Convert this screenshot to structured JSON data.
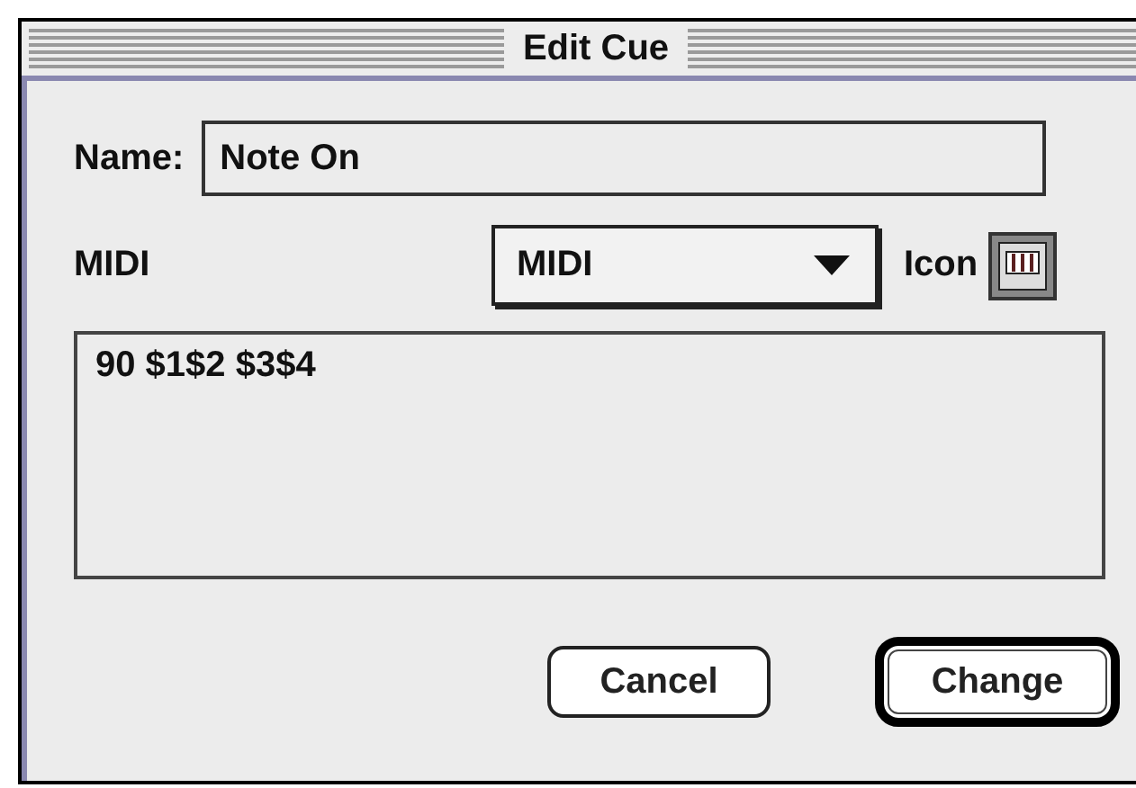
{
  "window": {
    "title": "Edit Cue"
  },
  "name_field": {
    "label": "Name:",
    "value": "Note On"
  },
  "midi_row": {
    "label": "MIDI",
    "dropdown": "MIDI",
    "icon_label": "Icon"
  },
  "message_text": "90 $1$2 $3$4",
  "buttons": [
    {
      "label": "Cancel",
      "default": false
    },
    {
      "label": "Change",
      "default": true
    }
  ]
}
